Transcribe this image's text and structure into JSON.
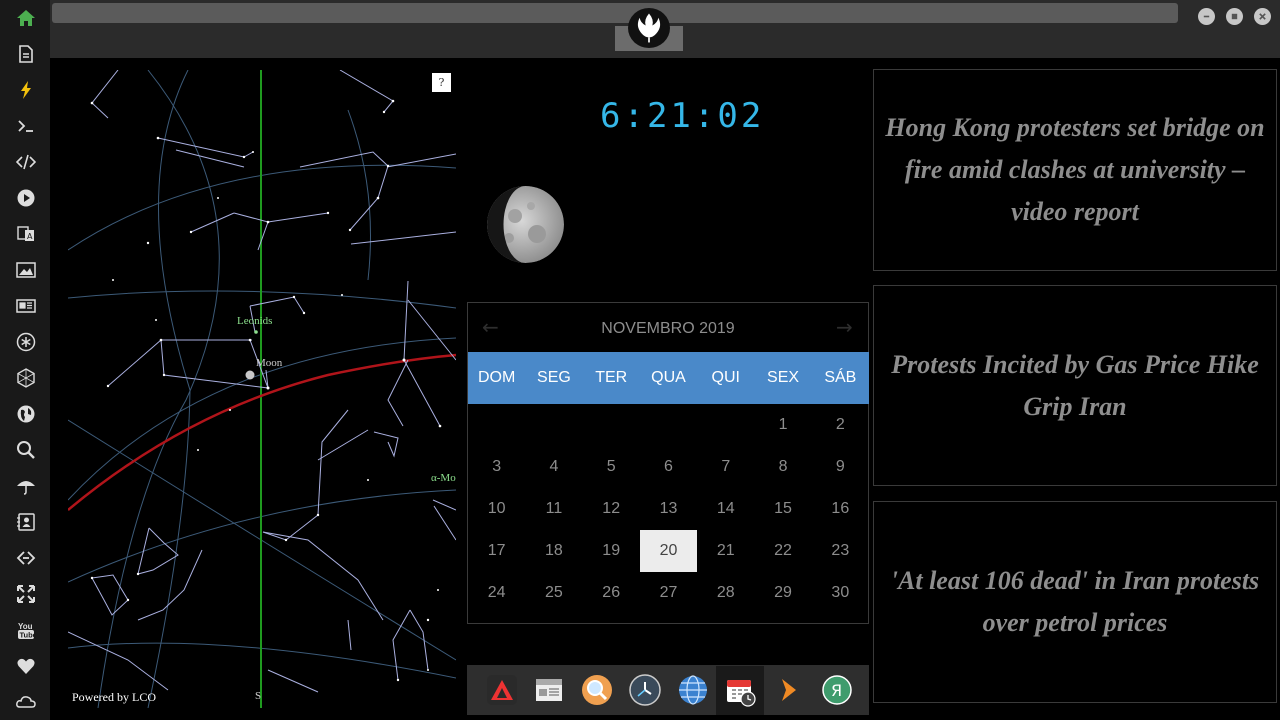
{
  "sidebar": {
    "items": [
      {
        "icon": "home-icon",
        "color": "#4caf50"
      },
      {
        "icon": "document-icon"
      },
      {
        "icon": "lightning-icon",
        "color": "#f4c20d"
      },
      {
        "icon": "terminal-icon"
      },
      {
        "icon": "code-icon"
      },
      {
        "icon": "play-icon"
      },
      {
        "icon": "translate-icon"
      },
      {
        "icon": "image-icon"
      },
      {
        "icon": "news-icon"
      },
      {
        "icon": "asterisk-icon"
      },
      {
        "icon": "hexagon-icon"
      },
      {
        "icon": "globe-icon"
      },
      {
        "icon": "search-icon"
      },
      {
        "icon": "umbrella-icon"
      },
      {
        "icon": "contacts-icon"
      },
      {
        "icon": "link-icon"
      },
      {
        "icon": "fullscreen-icon"
      },
      {
        "icon": "youtube-icon"
      },
      {
        "icon": "heart-icon"
      },
      {
        "icon": "cloud-icon"
      }
    ]
  },
  "window": {
    "emblem": "rebel-alliance-logo"
  },
  "skymap": {
    "help": "?",
    "powered_by": "Powered by LCO",
    "labels": {
      "leonids": "Leonids",
      "moon": "Moon",
      "alpha": "α-Mo",
      "south": "S"
    },
    "colors": {
      "ecliptic": "#b0141a",
      "meridian": "#1f9b1f",
      "lines": "#aab0e0",
      "grid": "#3c5a78"
    }
  },
  "clock": {
    "time": "6:21:02",
    "color": "#35b7e8"
  },
  "calendar": {
    "title": "NOVEMBRO 2019",
    "prev": "←",
    "next": "→",
    "weekdays": [
      "DOM",
      "SEG",
      "TER",
      "QUA",
      "QUI",
      "SEX",
      "SÁB"
    ],
    "weeks": [
      [
        "",
        "",
        "",
        "",
        "",
        "1",
        "2"
      ],
      [
        "3",
        "4",
        "5",
        "6",
        "7",
        "8",
        "9"
      ],
      [
        "10",
        "11",
        "12",
        "13",
        "14",
        "15",
        "16"
      ],
      [
        "17",
        "18",
        "19",
        "20",
        "21",
        "22",
        "23"
      ],
      [
        "24",
        "25",
        "26",
        "27",
        "28",
        "29",
        "30"
      ]
    ],
    "today": "20",
    "header_color": "#4a89c9"
  },
  "dock": {
    "items": [
      {
        "icon": "vivaldi-icon"
      },
      {
        "icon": "calendar-news-icon"
      },
      {
        "icon": "magnifier-icon"
      },
      {
        "icon": "clock-icon"
      },
      {
        "icon": "web-globe-icon"
      },
      {
        "icon": "calendar-clock-icon",
        "active": true
      },
      {
        "icon": "arrow-right-icon"
      },
      {
        "icon": "yandex-icon"
      }
    ]
  },
  "news": [
    {
      "headline": "Hong Kong protesters set bridge on fire amid clashes at university – video report"
    },
    {
      "headline": "Protests Incited by Gas Price Hike Grip Iran"
    },
    {
      "headline": "'At least 106 dead' in Iran protests over petrol prices"
    }
  ]
}
